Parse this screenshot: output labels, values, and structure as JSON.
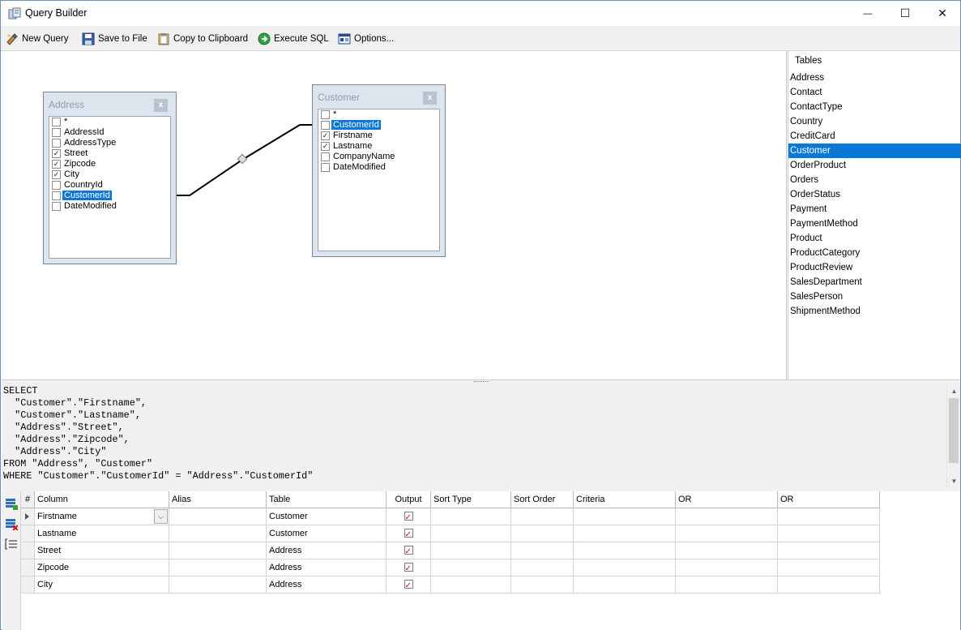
{
  "window": {
    "title": "Query Builder",
    "minimize_glyph": "—",
    "maximize_glyph": "☐",
    "close_glyph": "✕"
  },
  "toolbar": {
    "new_query": "New Query",
    "save_to_file": "Save to File",
    "copy_to_clipboard": "Copy to Clipboard",
    "execute_sql": "Execute SQL",
    "options": "Options..."
  },
  "diagram": {
    "address": {
      "title": "Address",
      "close": "x",
      "fields": [
        {
          "name": "*",
          "checked": false,
          "selected": false
        },
        {
          "name": "AddressId",
          "checked": false,
          "selected": false
        },
        {
          "name": "AddressType",
          "checked": false,
          "selected": false
        },
        {
          "name": "Street",
          "checked": true,
          "selected": false
        },
        {
          "name": "Zipcode",
          "checked": true,
          "selected": false
        },
        {
          "name": "City",
          "checked": true,
          "selected": false
        },
        {
          "name": "CountryId",
          "checked": false,
          "selected": false
        },
        {
          "name": "CustomerId",
          "checked": false,
          "selected": true
        },
        {
          "name": "DateModified",
          "checked": false,
          "selected": false
        }
      ]
    },
    "customer": {
      "title": "Customer",
      "close": "x",
      "fields": [
        {
          "name": "*",
          "checked": false,
          "selected": false
        },
        {
          "name": "CustomerId",
          "checked": false,
          "selected": true
        },
        {
          "name": "Firstname",
          "checked": true,
          "selected": false
        },
        {
          "name": "Lastname",
          "checked": true,
          "selected": false
        },
        {
          "name": "CompanyName",
          "checked": false,
          "selected": false
        },
        {
          "name": "DateModified",
          "checked": false,
          "selected": false
        }
      ]
    }
  },
  "tables_panel": {
    "header": "Tables",
    "selected": "Customer",
    "items": [
      "Address",
      "Contact",
      "ContactType",
      "Country",
      "CreditCard",
      "Customer",
      "OrderProduct",
      "Orders",
      "OrderStatus",
      "Payment",
      "PaymentMethod",
      "Product",
      "ProductCategory",
      "ProductReview",
      "SalesDepartment",
      "SalesPerson",
      "ShipmentMethod"
    ]
  },
  "sql": {
    "text": "SELECT\n  \"Customer\".\"Firstname\",\n  \"Customer\".\"Lastname\",\n  \"Address\".\"Street\",\n  \"Address\".\"Zipcode\",\n  \"Address\".\"City\"\nFROM \"Address\", \"Customer\"\nWHERE \"Customer\".\"CustomerId\" = \"Address\".\"CustomerId\""
  },
  "grid": {
    "headers": {
      "num": "#",
      "column": "Column",
      "alias": "Alias",
      "table": "Table",
      "output": "Output",
      "sort_type": "Sort Type",
      "sort_order": "Sort Order",
      "criteria": "Criteria",
      "or1": "OR",
      "or2": "OR"
    },
    "rows": [
      {
        "column": "Firstname",
        "alias": "",
        "table": "Customer",
        "output": true,
        "sort_type": "",
        "sort_order": "",
        "criteria": "",
        "or1": "",
        "or2": ""
      },
      {
        "column": "Lastname",
        "alias": "",
        "table": "Customer",
        "output": true,
        "sort_type": "",
        "sort_order": "",
        "criteria": "",
        "or1": "",
        "or2": ""
      },
      {
        "column": "Street",
        "alias": "",
        "table": "Address",
        "output": true,
        "sort_type": "",
        "sort_order": "",
        "criteria": "",
        "or1": "",
        "or2": ""
      },
      {
        "column": "Zipcode",
        "alias": "",
        "table": "Address",
        "output": true,
        "sort_type": "",
        "sort_order": "",
        "criteria": "",
        "or1": "",
        "or2": ""
      },
      {
        "column": "City",
        "alias": "",
        "table": "Address",
        "output": true,
        "sort_type": "",
        "sort_order": "",
        "criteria": "",
        "or1": "",
        "or2": ""
      }
    ]
  },
  "colors": {
    "selection": "#0a78d7",
    "check_red": "#dd1111",
    "table_box_bg": "#dce4ee"
  }
}
